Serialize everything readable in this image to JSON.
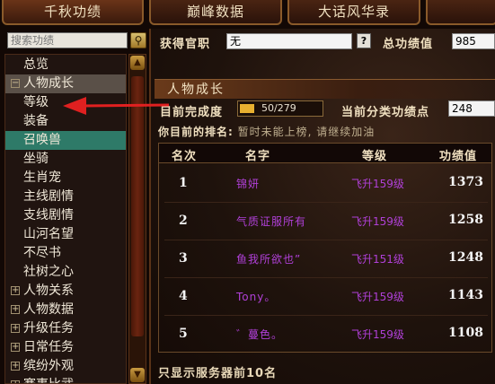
{
  "tabs": [
    "千秋功绩",
    "巅峰数据",
    "大话风华录",
    ""
  ],
  "search": {
    "placeholder": "搜索功绩"
  },
  "tree": {
    "items": [
      {
        "label": "总览",
        "expander": ""
      },
      {
        "label": "人物成长",
        "expander": "−"
      },
      {
        "label": "等级",
        "expander": ""
      },
      {
        "label": "装备",
        "expander": ""
      },
      {
        "label": "召唤兽",
        "expander": ""
      },
      {
        "label": "坐骑",
        "expander": ""
      },
      {
        "label": "生肖宠",
        "expander": ""
      },
      {
        "label": "主线剧情",
        "expander": ""
      },
      {
        "label": "支线剧情",
        "expander": ""
      },
      {
        "label": "山河名望",
        "expander": ""
      },
      {
        "label": "不尽书",
        "expander": ""
      },
      {
        "label": "社树之心",
        "expander": ""
      },
      {
        "label": "人物关系",
        "expander": "+"
      },
      {
        "label": "人物数据",
        "expander": "+"
      },
      {
        "label": "升级任务",
        "expander": "+"
      },
      {
        "label": "日常任务",
        "expander": "+"
      },
      {
        "label": "缤纷外观",
        "expander": "+"
      },
      {
        "label": "赛事比武",
        "expander": "+"
      }
    ]
  },
  "header": {
    "title_label": "获得官职",
    "title_value": "无",
    "help": "?",
    "total_label": "总功绩值",
    "total_value": "985"
  },
  "section": {
    "title": "人物成长",
    "progress_label": "目前完成度",
    "progress_text": "50/279",
    "progress_fraction": 0.179,
    "category_label": "当前分类功绩点",
    "category_value": "248",
    "rank_prefix": "你目前的排名:",
    "rank_note": "暂时未能上榜, 请继续加油"
  },
  "table": {
    "headers": {
      "rank": "名次",
      "name": "名字",
      "level": "等级",
      "score": "功绩值"
    },
    "rows": [
      {
        "rank": "1",
        "name": "锦妍",
        "level": "飞升159级",
        "score": "1373"
      },
      {
        "rank": "2",
        "name": "气质证服所有",
        "level": "飞升159级",
        "score": "1258"
      },
      {
        "rank": "3",
        "name": "鱼我所欲也”",
        "level": "飞升151级",
        "score": "1248"
      },
      {
        "rank": "4",
        "name": "Tony。",
        "level": "飞升159级",
        "score": "1143"
      },
      {
        "rank": "5",
        "name": "゛蔓色。",
        "level": "飞升159级",
        "score": "1108"
      }
    ]
  },
  "footer": "只显示服务器前10名",
  "colors": {
    "accent_purple": "#b040d8",
    "selected": "#2e7a68",
    "arrow": "#e02020"
  }
}
